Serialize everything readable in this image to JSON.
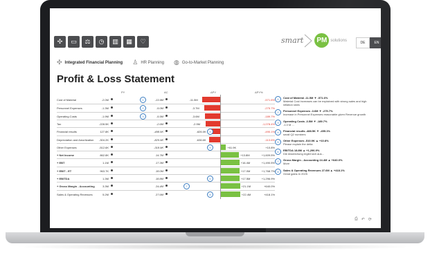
{
  "toolbar": {
    "buttons": [
      "arrows-icon",
      "chart-icon",
      "balance-icon",
      "clock-icon",
      "bar-chart-icon",
      "table-icon",
      "thumb-icon"
    ]
  },
  "logo": {
    "smart": "smart",
    "pm": "PM",
    "solutions": "solutions"
  },
  "lang": {
    "de": "DE",
    "en": "EN"
  },
  "nav": {
    "tabs": [
      {
        "label": "Integrated Financial Planning",
        "icon": "arrows-icon"
      },
      {
        "label": "HR Planning",
        "icon": "people-icon"
      },
      {
        "label": "Go-to-Market Planning",
        "icon": "globe-icon"
      }
    ]
  },
  "title": "Profit & Loss Statement",
  "headers": {
    "py": "PY",
    "ac": "AC",
    "dpy": "ΔPY",
    "dpyp": "ΔPY%"
  },
  "rows": [
    {
      "label": "Cost of Material",
      "py": "-2.0M",
      "ac": "-13.6M",
      "delta": "-11.5M",
      "pct": "-571.6%",
      "marker": "1"
    },
    {
      "label": "Personnel Expenses",
      "py": "-1.3M",
      "ac": "-5.0M",
      "delta": "-3.7M",
      "pct": "-275.7%",
      "marker": "2"
    },
    {
      "label": "Operating Costs",
      "py": "-1.9M",
      "ac": "-5.5M",
      "delta": "-3.6M",
      "pct": "-189.7%",
      "marker": "3"
    },
    {
      "label": "Tax",
      "py": "-228.5K",
      "ac": "-2.6M",
      "delta": "-2.5M",
      "pct": "-1,078.4%",
      "marker": ""
    },
    {
      "label": "Financial results",
      "py": "127.8K",
      "ac": "-498.5K",
      "delta": "-626.0K",
      "pct": "-490.1%",
      "marker": "4"
    },
    {
      "label": "Depreciation and Amortization",
      "py": "-304.2K",
      "ac": "-825.9K",
      "delta": "-636.6K",
      "pct": "-113.6%",
      "marker": ""
    },
    {
      "label": "Other Expenses",
      "py": "-512.6K",
      "ac": "-318.9K",
      "delta": "+61.9K",
      "pct": "+10.8%",
      "marker": "5"
    },
    {
      "label": "Net Income",
      "py": "862.8K",
      "ac": "14.7M",
      "delta": "+13.8M",
      "pct": "+1,609.5%",
      "marker": "",
      "bold": true
    },
    {
      "label": "EBT",
      "py": "1.1M",
      "ac": "17.3M",
      "delta": "+16.4M",
      "pct": "+1,490.5%",
      "marker": "",
      "bold": true
    },
    {
      "label": "EBIT - ET",
      "py": "963.7K",
      "ac": "18.0M",
      "delta": "+17.0M",
      "pct": "+1,768.7%",
      "marker": "",
      "bold": true
    },
    {
      "label": "EBITDA",
      "py": "1.3M",
      "ac": "18.8M",
      "delta": "+17.5M",
      "pct": "+1,296.9%",
      "marker": "6",
      "bold": true
    },
    {
      "label": "Gross Margin - Accounting",
      "py": "3.3M",
      "ac": "24.4M",
      "delta": "+21.1M",
      "pct": "+640.0%",
      "marker": "7",
      "bold": true
    },
    {
      "label": "Sales & Operating Revenues",
      "py": "5.2M",
      "ac": "27.6M",
      "delta": "+22.4M",
      "pct": "+418.1%",
      "marker": "8"
    }
  ],
  "notes": [
    {
      "n": "1",
      "head": "Cost of Material -11.5M ▼ -571.6%",
      "body": "Material Cost increases can be explained with strong sales and high inflation rates"
    },
    {
      "n": "2",
      "head": "Personnel Expenses -3.6M ▼ -275.7%",
      "body": "Increase in Personnel Expenses reasonable given Revenue growth"
    },
    {
      "n": "3",
      "head": "Operating Costs -3.5M ▼ -189.7%",
      "body": "-1.0 M ..."
    },
    {
      "n": "4",
      "head": "Financial results -488.5K ▼ -455.1%",
      "body": "small Q2 numbers"
    },
    {
      "n": "5",
      "head": "Other Expenses -510.9K ▲ +10.8%",
      "body": "Please explain the delta"
    },
    {
      "n": "6",
      "head": "EBITDA 18.8M ▲ +1,296.9%",
      "body": "Die Abweichung ergibt sich aus..."
    },
    {
      "n": "7",
      "head": "Gross Margin - Accounting 24.4M ▲ +640.0%",
      "body": "More"
    },
    {
      "n": "8",
      "head": "Sales & Operating Revenues 27.6M ▲ +418.1%",
      "body": "Great gains in 2025"
    }
  ],
  "colors": {
    "negative": "#e23a2e",
    "positive": "#7ac143",
    "accent": "#3a7cc1"
  }
}
